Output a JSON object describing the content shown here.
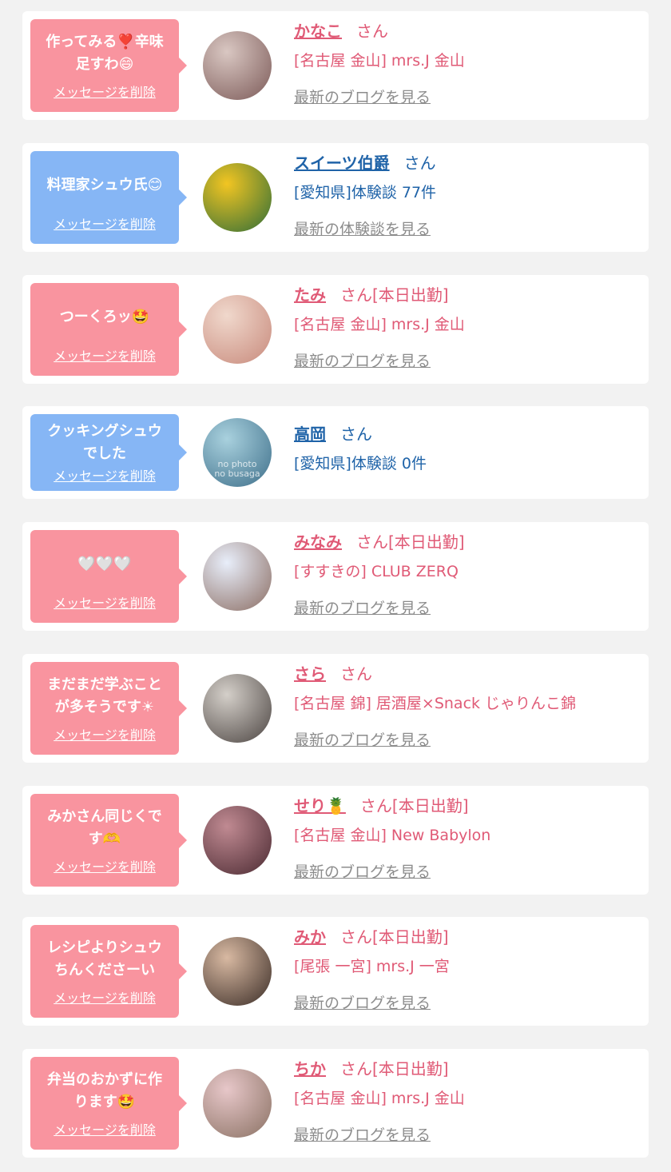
{
  "delete_label": "メッセージを削除",
  "cards": [
    {
      "theme": "pink",
      "message": "作ってみる❣️辛味\n足すわ😄",
      "name": "かなこ",
      "suffix": "さん",
      "detail": "[名古屋 金山] mrs.J 金山",
      "link": "最新のブログを見る",
      "avatar_colors": [
        "#d9c7c2",
        "#7c5a58"
      ]
    },
    {
      "theme": "blue",
      "message": "料理家シュウ氏😊",
      "name": "スイーツ伯爵",
      "suffix": "さん",
      "detail": "[愛知県]体験談 77件",
      "link": "最新の体験談を見る",
      "avatar_colors": [
        "#f2c522",
        "#2f6d38"
      ]
    },
    {
      "theme": "pink",
      "message": "つーくろッ🤩",
      "name": "たみ",
      "suffix": "さん[本日出勤]",
      "detail": "[名古屋 金山] mrs.J 金山",
      "link": "最新のブログを見る",
      "avatar_colors": [
        "#f0d8cc",
        "#c88a7c"
      ]
    },
    {
      "theme": "blue",
      "message": "クッキングシュウ\nでした",
      "name": "高岡",
      "suffix": "さん",
      "detail": "[愛知県]体験談 0件",
      "link": "",
      "avatar_colors": [
        "#a9d1de",
        "#3e6f8a"
      ],
      "avatar_label": "no photo\nno busaga"
    },
    {
      "theme": "pink",
      "message": "🤍🤍🤍",
      "name": "みなみ",
      "suffix": "さん[本日出勤]",
      "detail": "[すすきの] CLUB ZERQ",
      "link": "最新のブログを見る",
      "avatar_colors": [
        "#e8eefa",
        "#8b6d63"
      ]
    },
    {
      "theme": "pink",
      "message": "まだまだ学ぶこと\nが多そうです☀",
      "name": "さら",
      "suffix": "さん",
      "detail": "[名古屋 錦] 居酒屋×Snack じゃりんこ錦",
      "link": "最新のブログを見る",
      "avatar_colors": [
        "#d4cfc9",
        "#4c4542"
      ]
    },
    {
      "theme": "pink",
      "message": "みかさん同じくで\nす🫶",
      "name": "せり🍍",
      "suffix": "さん[本日出勤]",
      "detail": "[名古屋 金山] New Babylon",
      "link": "最新のブログを見る",
      "avatar_colors": [
        "#c08a92",
        "#4b2a32"
      ]
    },
    {
      "theme": "pink",
      "message": "レシピよりシュウ\nちんくださーい",
      "name": "みか",
      "suffix": "さん[本日出勤]",
      "detail": "[尾張 一宮] mrs.J 一宮",
      "link": "最新のブログを見る",
      "avatar_colors": [
        "#d8b9a2",
        "#3a2c26"
      ]
    },
    {
      "theme": "pink",
      "message": "弁当のおかずに作\nります🤩",
      "name": "ちか",
      "suffix": "さん[本日出勤]",
      "detail": "[名古屋 金山] mrs.J 金山",
      "link": "最新のブログを見る",
      "avatar_colors": [
        "#e7c7c9",
        "#8a7163"
      ]
    }
  ]
}
